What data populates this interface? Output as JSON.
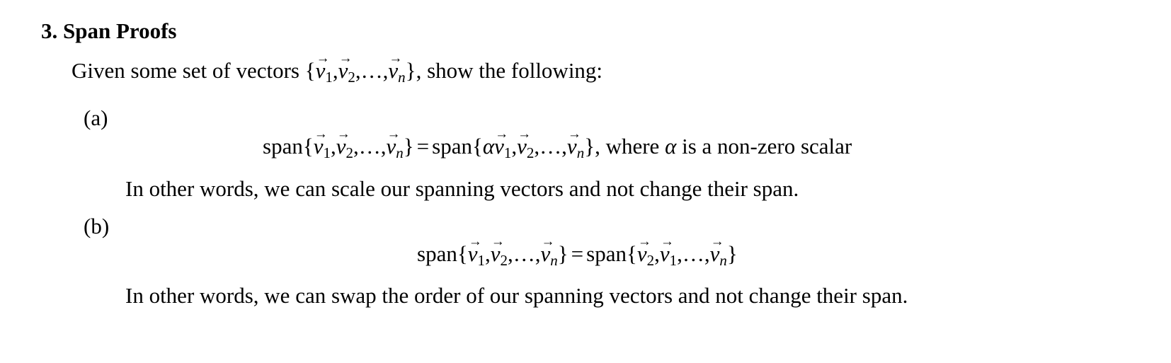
{
  "section": {
    "number": "3.",
    "title": "Span Proofs"
  },
  "intro": {
    "prefix": "Given some set of vectors",
    "suffix": ", show the following:"
  },
  "parts": [
    {
      "label": "(a)",
      "equation": {
        "lhs_word": "span",
        "rhs_word": "span",
        "scalar": "α",
        "equals": "=",
        "condition_prefix": ", where",
        "condition_suffix": "is a non-zero scalar"
      },
      "remark": "In other words, we can scale our spanning vectors and not change their span."
    },
    {
      "label": "(b)",
      "equation": {
        "lhs_word": "span",
        "rhs_word": "span",
        "equals": "="
      },
      "remark": "In other words, we can swap the order of our spanning vectors and not change their span."
    }
  ],
  "math": {
    "vector_letter": "v",
    "arrow": "→",
    "sub1": "1",
    "sub2": "2",
    "subn": "n",
    "dots": "…",
    "comma": ",",
    "lbrace": "{",
    "rbrace": "}"
  }
}
